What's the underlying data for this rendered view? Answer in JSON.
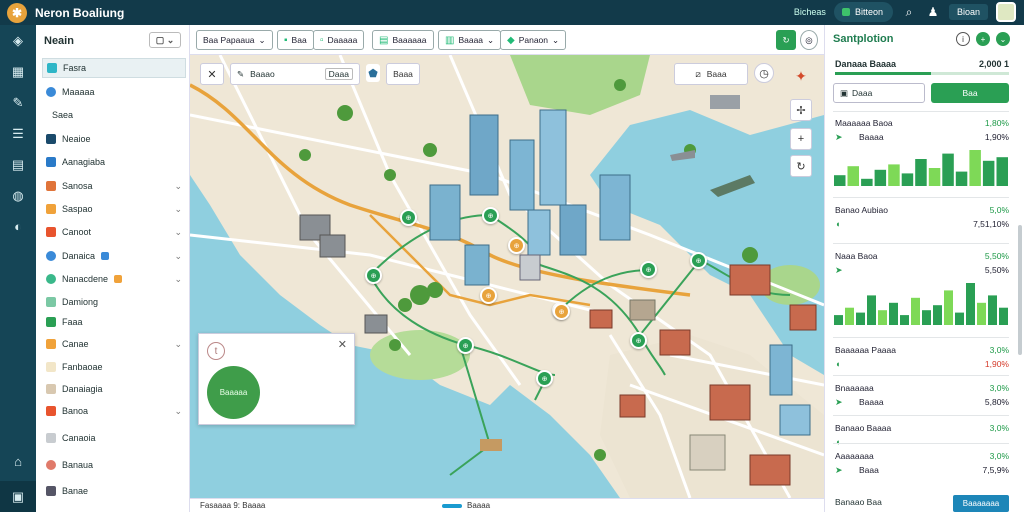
{
  "app": {
    "title": "Neron Boaliung"
  },
  "topbar": {
    "link": "Bicheas",
    "pill": "Bitteon",
    "user": "Bioan",
    "icons": [
      "search-icon",
      "user-icon"
    ]
  },
  "rail": {
    "icons": [
      "layers-icon",
      "grid-icon",
      "pen-icon",
      "list-icon",
      "chart-icon",
      "globe-icon",
      "shield-icon",
      "museum-icon",
      "building-icon"
    ]
  },
  "panel": {
    "title": "Neain",
    "items": [
      {
        "label": "Fasra",
        "color": "#2fb6c7",
        "round": false,
        "selected": true,
        "chevron": false,
        "badge": ""
      },
      {
        "label": "Maaaaa",
        "color": "#3a8ad8",
        "round": true,
        "selected": false,
        "chevron": false,
        "badge": ""
      },
      {
        "label": "Saea",
        "color": "",
        "round": false,
        "selected": false,
        "chevron": false,
        "badge": ""
      },
      {
        "label": "Neaioe",
        "color": "#1a4a6b",
        "round": false,
        "selected": false,
        "chevron": false,
        "badge": ""
      },
      {
        "label": "Aanagiaba",
        "color": "#2a7ac8",
        "round": false,
        "selected": false,
        "chevron": false,
        "badge": ""
      },
      {
        "label": "Sanosa",
        "color": "#e0743a",
        "round": false,
        "selected": false,
        "chevron": true,
        "badge": ""
      },
      {
        "label": "Saspao",
        "color": "#f0a23a",
        "round": false,
        "selected": false,
        "chevron": true,
        "badge": ""
      },
      {
        "label": "Canoot",
        "color": "#e8542e",
        "round": false,
        "selected": false,
        "chevron": true,
        "badge": ""
      },
      {
        "label": "Danaica",
        "color": "#3a8ad8",
        "round": true,
        "selected": false,
        "chevron": true,
        "badge": "blue"
      },
      {
        "label": "Nanacdene",
        "color": "#3ab88a",
        "round": true,
        "selected": false,
        "chevron": true,
        "badge": "orange"
      },
      {
        "label": "Damiong",
        "color": "#7bc8a4",
        "round": false,
        "selected": false,
        "chevron": false,
        "badge": ""
      },
      {
        "label": "Faaa",
        "color": "#2a9f54",
        "round": false,
        "selected": false,
        "chevron": false,
        "badge": ""
      },
      {
        "label": "Canae",
        "color": "#f0a23a",
        "round": false,
        "selected": false,
        "chevron": true,
        "badge": ""
      },
      {
        "label": "Fanbaoae",
        "color": "#f2e6c8",
        "round": false,
        "selected": false,
        "chevron": false,
        "badge": ""
      },
      {
        "label": "Danaiagia",
        "color": "#d8c8b0",
        "round": false,
        "selected": false,
        "chevron": false,
        "badge": ""
      },
      {
        "label": "Banoa",
        "color": "#e8542e",
        "round": false,
        "selected": false,
        "chevron": true,
        "badge": ""
      },
      {
        "label": "Canaoia",
        "color": "#c8ccd0",
        "round": false,
        "selected": false,
        "chevron": false,
        "badge": ""
      },
      {
        "label": "Banaua",
        "color": "#e07a6a",
        "round": true,
        "selected": false,
        "chevron": false,
        "badge": ""
      },
      {
        "label": "Banae",
        "color": "#556",
        "round": false,
        "selected": false,
        "chevron": false,
        "badge": ""
      }
    ]
  },
  "toolbar": {
    "buttons": [
      {
        "label": "Baa Papaaua",
        "icon": "filter-icon"
      },
      {
        "label": "Baa",
        "icon": "bookmark-icon"
      },
      {
        "label": "Daaaaa",
        "icon": "calendar-icon"
      },
      {
        "label": "Baaaaaa",
        "icon": "table-icon"
      },
      {
        "label": "Baaaa",
        "icon": "layers-icon"
      },
      {
        "label": "Panaon",
        "icon": "pin-icon"
      }
    ]
  },
  "map": {
    "search_placeholder": "Baaao",
    "search_btn": "Daaa",
    "filter_btn": "Baaa",
    "measure_label": "Baaa",
    "popup": {
      "donut_label": "Baaaaa"
    },
    "route_nodes": [
      {
        "id": "A",
        "kind": "green"
      },
      {
        "id": "B",
        "kind": "green"
      },
      {
        "id": "C",
        "kind": "orange"
      },
      {
        "id": "D",
        "kind": "green"
      },
      {
        "id": "E",
        "kind": "orange"
      },
      {
        "id": "F",
        "kind": "green"
      },
      {
        "id": "G",
        "kind": "green"
      },
      {
        "id": "H",
        "kind": "green"
      },
      {
        "id": "I",
        "kind": "green"
      },
      {
        "id": "J",
        "kind": "green"
      },
      {
        "id": "K",
        "kind": "green"
      },
      {
        "id": "L",
        "kind": "orange"
      }
    ]
  },
  "status": {
    "left": "Fasaaaa 9: Baaaa",
    "middle": "Baaaa"
  },
  "side": {
    "title": "Santplotion",
    "kpi": {
      "label": "Danaaa Baaaa",
      "value": "2,000 1"
    },
    "input_value": "Daaa",
    "button": "Baa",
    "metrics": [
      {
        "title": "Maaaaaa Baoa",
        "value": "1,80%",
        "sub": "Baaaa",
        "subv": "1,90%",
        "bars": [
          30,
          55,
          20,
          45,
          60,
          35,
          75,
          50,
          90,
          40,
          100,
          70,
          80
        ]
      },
      {
        "title": "Banao Aubiao",
        "value": "5,0%",
        "sub": "",
        "subv": "7,51,10%",
        "bars": []
      },
      {
        "title": "Naaa Baoa",
        "value": "5,50%",
        "sub": "",
        "subv": "5,50%",
        "bars": [
          20,
          35,
          25,
          60,
          30,
          45,
          20,
          55,
          30,
          40,
          70,
          25,
          85,
          45,
          60,
          35
        ]
      },
      {
        "title": "Baaaaaa Paaaa",
        "value": "3,0%",
        "sub": "",
        "subv": "1,90%",
        "bars": []
      },
      {
        "title": "Bnaaaaaa",
        "value": "3,0%",
        "sub": "Baaaa",
        "subv": "5,80%",
        "bars": []
      },
      {
        "title": "Banaao Baaaa",
        "value": "3,0%",
        "sub": "",
        "subv": "",
        "bars": []
      },
      {
        "title": "Aaaaaaaa",
        "value": "3,0%",
        "sub": "Baaa",
        "subv": "7,5,9%",
        "bars": []
      }
    ],
    "footer": "Banaao Baa",
    "footer_btn": "Baaaaaaa"
  },
  "colors": {
    "accent": "#2a9f54",
    "dark": "#123a4a",
    "water": "#8fcfdf",
    "route": "#e8a33c"
  }
}
